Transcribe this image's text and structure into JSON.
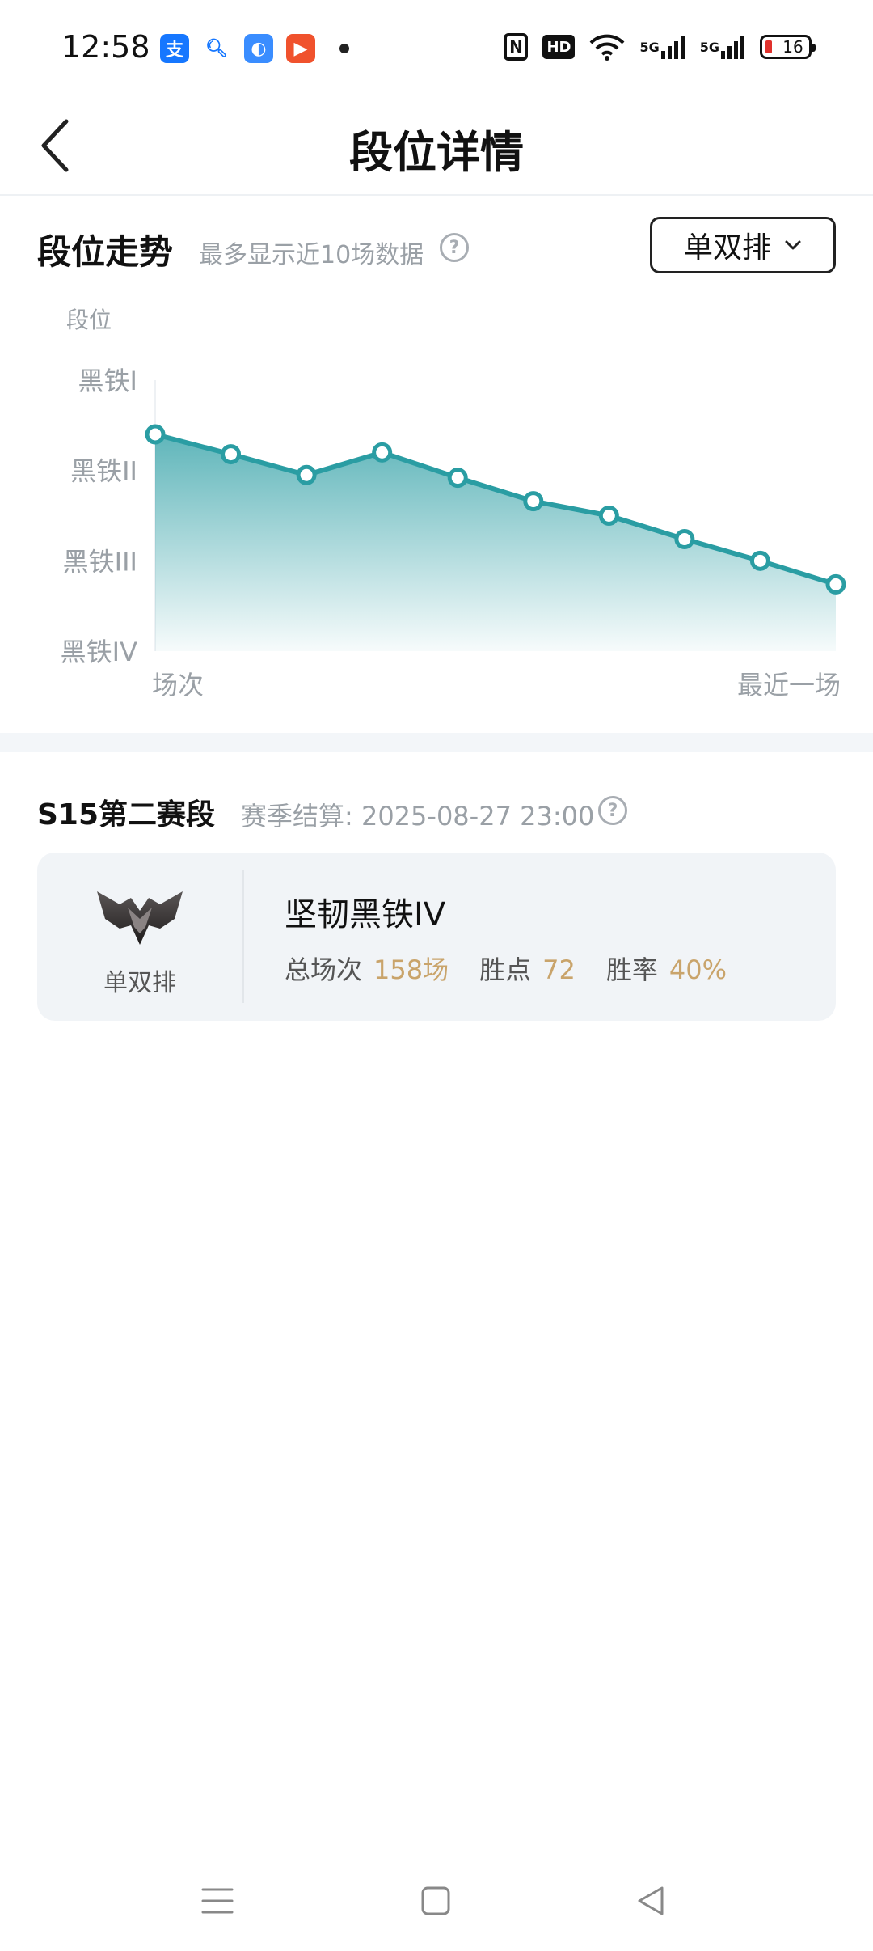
{
  "status_bar": {
    "time": "12:58",
    "battery_level": "16",
    "signal_label": "5G"
  },
  "header": {
    "title": "段位详情"
  },
  "trend": {
    "title": "段位走势",
    "subtitle": "最多显示近10场数据",
    "help_glyph": "?",
    "mode_label": "单双排"
  },
  "chart_data": {
    "type": "area",
    "ylabel": "段位",
    "xlabel_start": "场次",
    "xlabel_end": "最近一场",
    "y_ticks": [
      "黑铁I",
      "黑铁II",
      "黑铁III",
      "黑铁IV"
    ],
    "ylim": [
      0,
      3
    ],
    "values": [
      0.6,
      0.82,
      1.05,
      0.8,
      1.08,
      1.34,
      1.5,
      1.76,
      2.0,
      2.26
    ],
    "line_color": "#2a9da3",
    "fill_color": "#2a9da3"
  },
  "season": {
    "title": "S15第二赛段",
    "settle_text": "赛季结算: 2025-08-27 23:00",
    "help_glyph": "?",
    "card": {
      "queue": "单双排",
      "rank_name": "坚韧黑铁IV",
      "total_label": "总场次",
      "total_value": "158场",
      "lp_label": "胜点",
      "lp_value": "72",
      "winrate_label": "胜率",
      "winrate_value": "40%"
    }
  },
  "colors": {
    "accent_gold": "#c9a46b",
    "muted_text": "#9aa0a6"
  }
}
